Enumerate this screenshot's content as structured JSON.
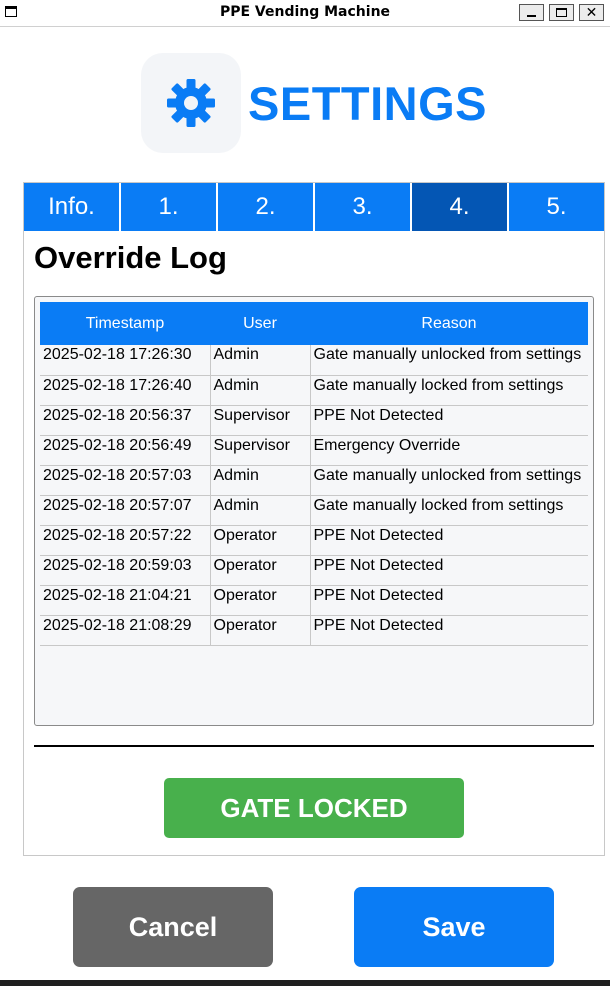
{
  "window": {
    "title": "PPE Vending Machine",
    "minimize_icon": "minimize-icon",
    "maximize_icon": "maximize-icon",
    "close_icon": "close-icon",
    "close_glyph": "✕"
  },
  "header": {
    "icon": "gear-icon",
    "title": "SETTINGS",
    "accent_color": "#0a7cf5"
  },
  "tabs": [
    {
      "label": "Info.",
      "active": false
    },
    {
      "label": "1.",
      "active": false
    },
    {
      "label": "2.",
      "active": false
    },
    {
      "label": "3.",
      "active": false
    },
    {
      "label": "4.",
      "active": true
    },
    {
      "label": "5.",
      "active": false
    }
  ],
  "override_log": {
    "title": "Override Log",
    "columns": [
      "Timestamp",
      "User",
      "Reason"
    ],
    "rows": [
      {
        "timestamp": "2025-02-18 17:26:30",
        "user": "Admin",
        "reason": "Gate manually unlocked from settings"
      },
      {
        "timestamp": "2025-02-18 17:26:40",
        "user": "Admin",
        "reason": "Gate manually locked from settings"
      },
      {
        "timestamp": "2025-02-18 20:56:37",
        "user": "Supervisor",
        "reason": "PPE Not Detected"
      },
      {
        "timestamp": "2025-02-18 20:56:49",
        "user": "Supervisor",
        "reason": "Emergency Override"
      },
      {
        "timestamp": "2025-02-18 20:57:03",
        "user": "Admin",
        "reason": "Gate manually unlocked from settings"
      },
      {
        "timestamp": "2025-02-18 20:57:07",
        "user": "Admin",
        "reason": "Gate manually locked from settings"
      },
      {
        "timestamp": "2025-02-18 20:57:22",
        "user": "Operator",
        "reason": "PPE Not Detected"
      },
      {
        "timestamp": "2025-02-18 20:59:03",
        "user": "Operator",
        "reason": "PPE Not Detected"
      },
      {
        "timestamp": "2025-02-18 21:04:21",
        "user": "Operator",
        "reason": "PPE Not Detected"
      },
      {
        "timestamp": "2025-02-18 21:08:29",
        "user": "Operator",
        "reason": "PPE Not Detected"
      }
    ]
  },
  "gate": {
    "status_label": "GATE LOCKED",
    "color": "#48b04c"
  },
  "actions": {
    "cancel_label": "Cancel",
    "save_label": "Save",
    "cancel_color": "#666666",
    "save_color": "#0a7cf5"
  }
}
